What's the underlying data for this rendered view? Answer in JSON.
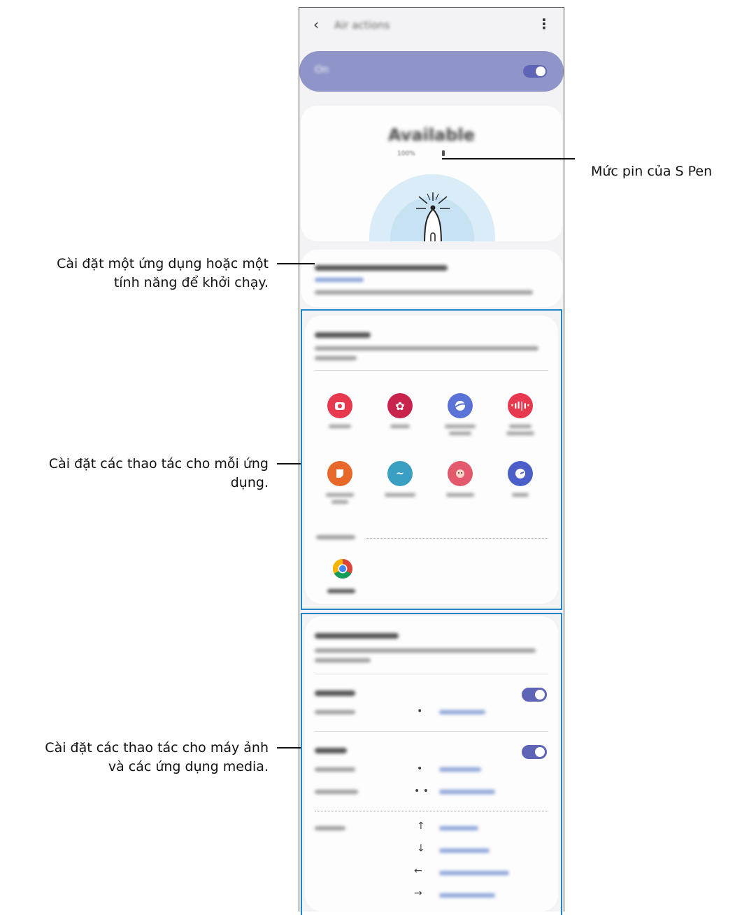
{
  "header": {
    "title": "Air actions",
    "back_icon": "‹",
    "more_icon": "⋮"
  },
  "master_switch": {
    "label": "On",
    "state": "on"
  },
  "status": {
    "title": "Available",
    "battery": "100%"
  },
  "hold_down": {
    "title": "Hold down Pen button to",
    "value": "Open Camera",
    "description": "Choose what happens when you hold down the Pen button."
  },
  "app_actions": {
    "title": "App actions",
    "description": "Choose what happens when you press the Pen button in these apps.",
    "apps": [
      {
        "name": "Camera",
        "icon": "camera-icon",
        "color": "#e8384f"
      },
      {
        "name": "Gallery",
        "icon": "gallery-icon",
        "color": "#c8234d"
      },
      {
        "name": "Samsung Internet",
        "icon": "internet-icon",
        "color": "#5b72d6"
      },
      {
        "name": "Voice Recorder",
        "icon": "voice-recorder-icon",
        "color": "#e8384f"
      },
      {
        "name": "Samsung Notes",
        "icon": "notes-icon",
        "color": "#e8682a"
      },
      {
        "name": "AR Doodle",
        "icon": "ar-doodle-icon",
        "color": "#3a9fc2"
      },
      {
        "name": "AR Emoji",
        "icon": "ar-emoji-icon",
        "color": "#e25a6c"
      },
      {
        "name": "Clock",
        "icon": "clock-icon",
        "color": "#4c5fc8"
      }
    ],
    "turned_off_label": "Turned off",
    "off_apps": [
      {
        "name": "Chrome",
        "icon": "chrome-icon"
      }
    ]
  },
  "general": {
    "title": "General controls",
    "description": "Control actions in the camera and media apps.",
    "camera": {
      "label": "Camera",
      "state": "on",
      "rows": [
        {
          "action": "Single press",
          "symbol": "•",
          "value": "Take picture"
        }
      ]
    },
    "media": {
      "label": "Media",
      "state": "on",
      "rows": [
        {
          "action": "Single press",
          "symbol": "•",
          "value": "Play/Pause"
        },
        {
          "action": "Double press",
          "symbol": "• •",
          "value": "Play next track"
        }
      ],
      "gestures_label": "Gestures",
      "gestures": [
        {
          "symbol": "↑",
          "value": "Volume up"
        },
        {
          "symbol": "↓",
          "value": "Volume down"
        },
        {
          "symbol": "←",
          "value": "Play previous track"
        },
        {
          "symbol": "→",
          "value": "Play next track"
        }
      ]
    }
  },
  "callouts": {
    "battery": "Mức pin của S Pen",
    "launch_line1": "Cài đặt một ứng dụng hoặc một",
    "launch_line2": "tính năng để khởi chạy.",
    "apps_line1": "Cài đặt các thao tác cho mỗi ứng",
    "apps_line2": "dụng.",
    "camera_line1": "Cài đặt các thao tác cho máy ảnh",
    "camera_line2": "và các ứng dụng media."
  },
  "colors": {
    "accent": "#5e65b7",
    "highlight": "#2185c5",
    "switch_bar": "#8f95c9"
  }
}
